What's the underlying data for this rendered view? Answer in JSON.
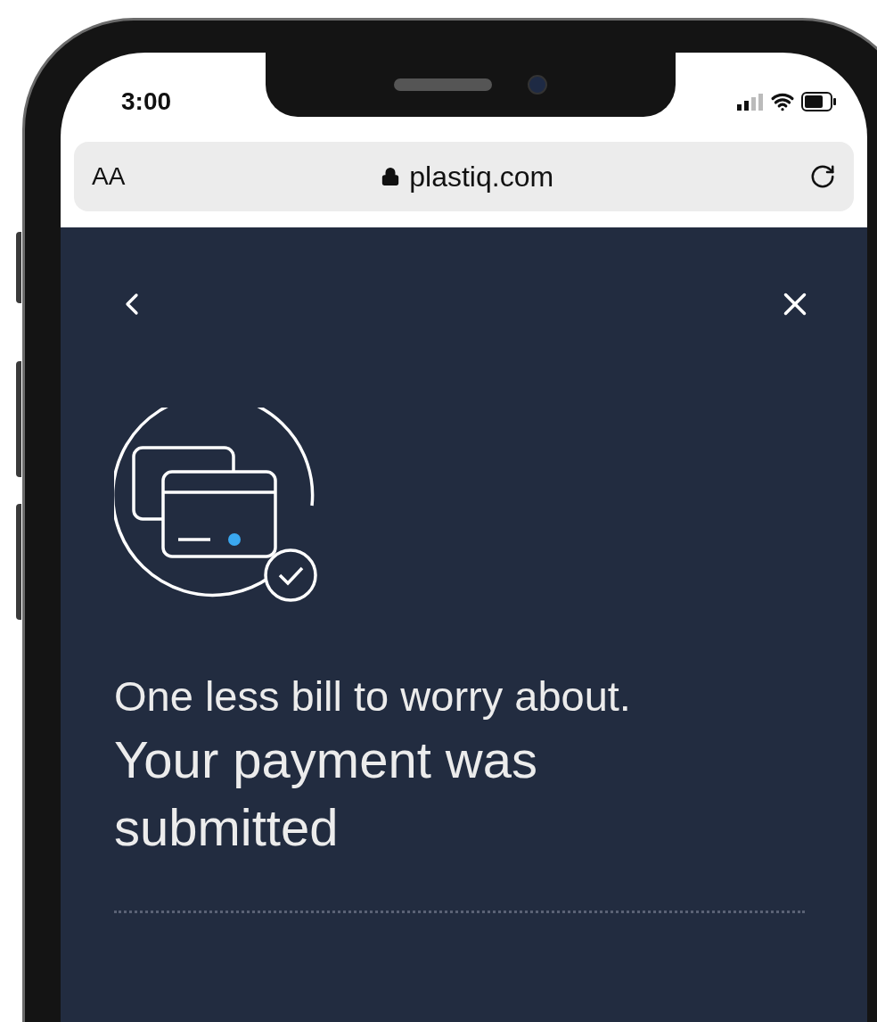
{
  "status_bar": {
    "time": "3:00"
  },
  "browser_bar": {
    "text_size": "AA",
    "url": "plastiq.com"
  },
  "page": {
    "heading": "One less bill to worry about.",
    "title": "Your payment was submitted"
  }
}
